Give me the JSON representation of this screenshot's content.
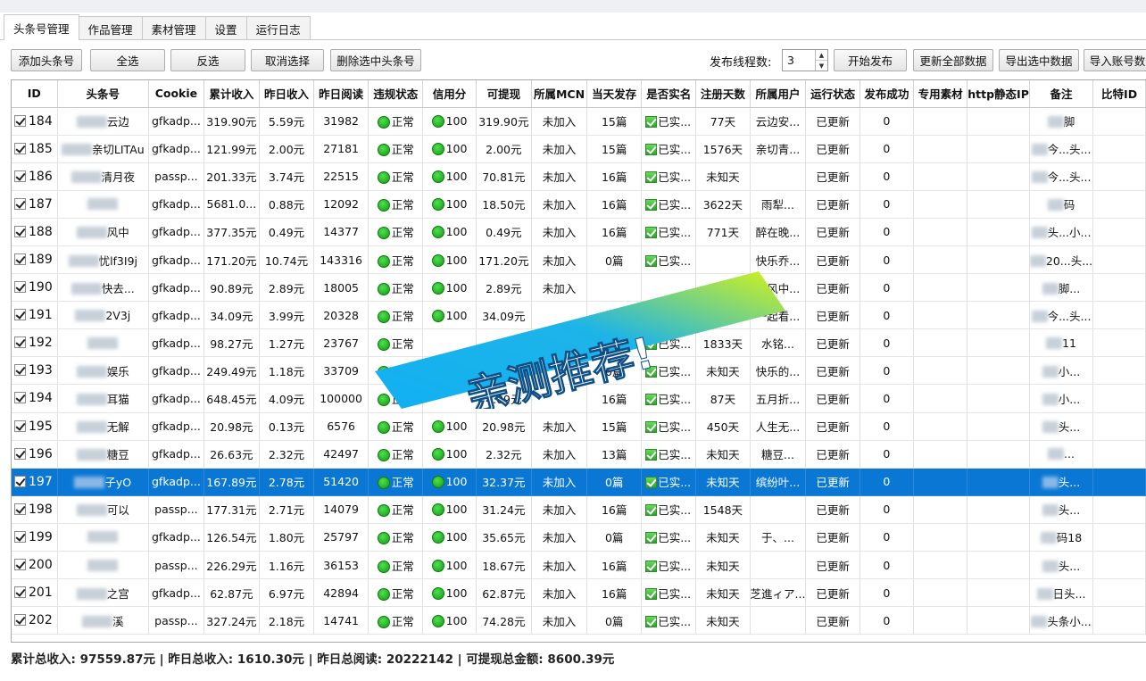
{
  "tabs": [
    "头条号管理",
    "作品管理",
    "素材管理",
    "设置",
    "运行日志"
  ],
  "active_tab": 0,
  "toolbar": {
    "add": "添加头条号",
    "select_all": "全选",
    "invert": "反选",
    "cancel": "取消选择",
    "delete": "删除选中头条号",
    "thread_label": "发布线程数:",
    "thread_value": "3",
    "start": "开始发布",
    "update_all": "更新全部数据",
    "export": "导出选中数据",
    "import": "导入账号数"
  },
  "columns": [
    "ID",
    "头条号",
    "Cookie",
    "累计收入",
    "昨日收入",
    "昨日阅读",
    "违规状态",
    "信用分",
    "可提现",
    "所属MCN",
    "当天发存",
    "是否实名",
    "注册天数",
    "所属用户",
    "运行状态",
    "发布成功",
    "专用素材",
    "http静态IP",
    "备注",
    "比特ID"
  ],
  "rows": [
    {
      "id": "184",
      "name": "云边",
      "cookie": "gfkadp...",
      "total": "319.90元",
      "yday": "5.59元",
      "read": "31982",
      "viol": "正常",
      "credit": "100",
      "withdraw": "319.90元",
      "mcn": "未加入",
      "daily": "15篇",
      "real": "已实...",
      "days": "77天",
      "user": "云边安...",
      "run": "已更新",
      "success": "0",
      "note": "脚"
    },
    {
      "id": "185",
      "name": "亲切LITAu",
      "cookie": "gfkadp...",
      "total": "121.99元",
      "yday": "2.00元",
      "read": "27181",
      "viol": "正常",
      "credit": "100",
      "withdraw": "2.00元",
      "mcn": "未加入",
      "daily": "15篇",
      "real": "已实...",
      "days": "1576天",
      "user": "亲切青...",
      "run": "已更新",
      "success": "0",
      "note": "今...头..."
    },
    {
      "id": "186",
      "name": "清月夜",
      "cookie": "passp...",
      "total": "201.33元",
      "yday": "3.74元",
      "read": "22515",
      "viol": "正常",
      "credit": "100",
      "withdraw": "70.81元",
      "mcn": "未加入",
      "daily": "16篇",
      "real": "已实...",
      "days": "未知天",
      "user": "",
      "run": "已更新",
      "success": "0",
      "note": "今...头..."
    },
    {
      "id": "187",
      "name": "",
      "cookie": "gfkadp...",
      "total": "5681.0...",
      "yday": "0.88元",
      "read": "12092",
      "viol": "正常",
      "credit": "100",
      "withdraw": "18.50元",
      "mcn": "未加入",
      "daily": "16篇",
      "real": "已实...",
      "days": "3622天",
      "user": "雨犁...",
      "run": "已更新",
      "success": "0",
      "note": "码"
    },
    {
      "id": "188",
      "name": "风中",
      "cookie": "gfkadp...",
      "total": "377.35元",
      "yday": "0.49元",
      "read": "14377",
      "viol": "正常",
      "credit": "100",
      "withdraw": "0.49元",
      "mcn": "未加入",
      "daily": "16篇",
      "real": "已实...",
      "days": "771天",
      "user": "醉在晚...",
      "run": "已更新",
      "success": "0",
      "note": "头...小..."
    },
    {
      "id": "189",
      "name": "忧lf3I9j",
      "cookie": "gfkadp...",
      "total": "171.20元",
      "yday": "10.74元",
      "read": "143316",
      "viol": "正常",
      "credit": "100",
      "withdraw": "171.20元",
      "mcn": "未加入",
      "daily": "0篇",
      "real": "已实...",
      "days": "",
      "user": "快乐乔...",
      "run": "已更新",
      "success": "0",
      "note": "20...头..."
    },
    {
      "id": "190",
      "name": "快去...",
      "cookie": "gfkadp...",
      "total": "90.89元",
      "yday": "2.89元",
      "read": "18005",
      "viol": "正常",
      "credit": "100",
      "withdraw": "2.89元",
      "mcn": "未加入",
      "daily": "",
      "real": "",
      "days": "",
      "user": "晨风中...",
      "run": "已更新",
      "success": "0",
      "note": "脚..."
    },
    {
      "id": "191",
      "name": "2V3j",
      "cookie": "gfkadp...",
      "total": "34.09元",
      "yday": "3.99元",
      "read": "20328",
      "viol": "正常",
      "credit": "100",
      "withdraw": "34.09元",
      "mcn": "",
      "daily": "",
      "real": "",
      "days": "",
      "user": "一起看...",
      "run": "已更新",
      "success": "0",
      "note": "今...头..."
    },
    {
      "id": "192",
      "name": "",
      "cookie": "gfkadp...",
      "total": "98.27元",
      "yday": "1.27元",
      "read": "23767",
      "viol": "正常",
      "credit": "",
      "withdraw": "",
      "mcn": "",
      "daily": "",
      "real": "已实...",
      "days": "1833天",
      "user": "水铭...",
      "run": "已更新",
      "success": "0",
      "note": "11"
    },
    {
      "id": "193",
      "name": "娱乐",
      "cookie": "gfkadp...",
      "total": "249.49元",
      "yday": "1.18元",
      "read": "33709",
      "viol": "正常",
      "credit": "",
      "withdraw": "",
      "mcn": "",
      "daily": "0篇",
      "real": "已实...",
      "days": "未知天",
      "user": "快乐的...",
      "run": "已更新",
      "success": "0",
      "note": "小..."
    },
    {
      "id": "194",
      "name": "耳猫",
      "cookie": "gfkadp...",
      "total": "648.45元",
      "yday": "4.09元",
      "read": "100000",
      "viol": "正常",
      "credit": "",
      "withdraw": "4.09元",
      "mcn": "",
      "daily": "16篇",
      "real": "已实...",
      "days": "87天",
      "user": "五月折...",
      "run": "已更新",
      "success": "0",
      "note": "小..."
    },
    {
      "id": "195",
      "name": "无解",
      "cookie": "gfkadp...",
      "total": "20.98元",
      "yday": "0.13元",
      "read": "6576",
      "viol": "正常",
      "credit": "100",
      "withdraw": "20.98元",
      "mcn": "未加入",
      "daily": "15篇",
      "real": "已实...",
      "days": "450天",
      "user": "人生无...",
      "run": "已更新",
      "success": "0",
      "note": "头..."
    },
    {
      "id": "196",
      "name": "糖豆",
      "cookie": "gfkadp...",
      "total": "26.63元",
      "yday": "2.32元",
      "read": "42497",
      "viol": "正常",
      "credit": "100",
      "withdraw": "2.32元",
      "mcn": "未加入",
      "daily": "13篇",
      "real": "已实...",
      "days": "未知天",
      "user": "糖豆...",
      "run": "已更新",
      "success": "0",
      "note": "..."
    },
    {
      "id": "197",
      "name": "子yO",
      "cookie": "gfkadp...",
      "total": "167.89元",
      "yday": "2.78元",
      "read": "51420",
      "viol": "正常",
      "credit": "100",
      "withdraw": "32.37元",
      "mcn": "未加入",
      "daily": "0篇",
      "real": "已实...",
      "days": "未知天",
      "user": "缤纷叶...",
      "run": "已更新",
      "success": "0",
      "note": "头..."
    },
    {
      "id": "198",
      "name": "可以",
      "cookie": "passp...",
      "total": "177.31元",
      "yday": "2.71元",
      "read": "14079",
      "viol": "正常",
      "credit": "100",
      "withdraw": "31.24元",
      "mcn": "未加入",
      "daily": "16篇",
      "real": "已实...",
      "days": "1548天",
      "user": "",
      "run": "已更新",
      "success": "0",
      "note": "头..."
    },
    {
      "id": "199",
      "name": "",
      "cookie": "gfkadp...",
      "total": "126.54元",
      "yday": "1.80元",
      "read": "25797",
      "viol": "正常",
      "credit": "100",
      "withdraw": "35.65元",
      "mcn": "未加入",
      "daily": "0篇",
      "real": "已实...",
      "days": "未知天",
      "user": "于、...",
      "run": "已更新",
      "success": "0",
      "note": "码18"
    },
    {
      "id": "200",
      "name": "",
      "cookie": "passp...",
      "total": "226.29元",
      "yday": "1.16元",
      "read": "36153",
      "viol": "正常",
      "credit": "100",
      "withdraw": "18.67元",
      "mcn": "未加入",
      "daily": "16篇",
      "real": "已实...",
      "days": "未知天",
      "user": "",
      "run": "已更新",
      "success": "0",
      "note": "头..."
    },
    {
      "id": "201",
      "name": "之宫",
      "cookie": "gfkadp...",
      "total": "62.87元",
      "yday": "6.97元",
      "read": "42894",
      "viol": "正常",
      "credit": "100",
      "withdraw": "62.87元",
      "mcn": "未加入",
      "daily": "16篇",
      "real": "已实...",
      "days": "未知天",
      "user": "芝進ィア...",
      "run": "已更新",
      "success": "0",
      "note": "日头..."
    },
    {
      "id": "202",
      "name": "溪",
      "cookie": "passp...",
      "total": "327.24元",
      "yday": "2.18元",
      "read": "14741",
      "viol": "正常",
      "credit": "100",
      "withdraw": "74.28元",
      "mcn": "未加入",
      "daily": "0篇",
      "real": "已实...",
      "days": "未知天",
      "user": "",
      "run": "已更新",
      "success": "0",
      "note": "头条小..."
    }
  ],
  "selected_row": "197",
  "summary": "累计总收入: 97559.87元 | 昨日总收入: 1610.30元 | 昨日总阅读: 20222142 | 可提现总金额: 8600.39元",
  "banner_text": "亲测推荐!",
  "colors": {
    "selection": "#0a77d5",
    "status_green": "#1fb51f",
    "banner_cyan": "#17b3f0",
    "banner_lime": "#c9f01f"
  }
}
